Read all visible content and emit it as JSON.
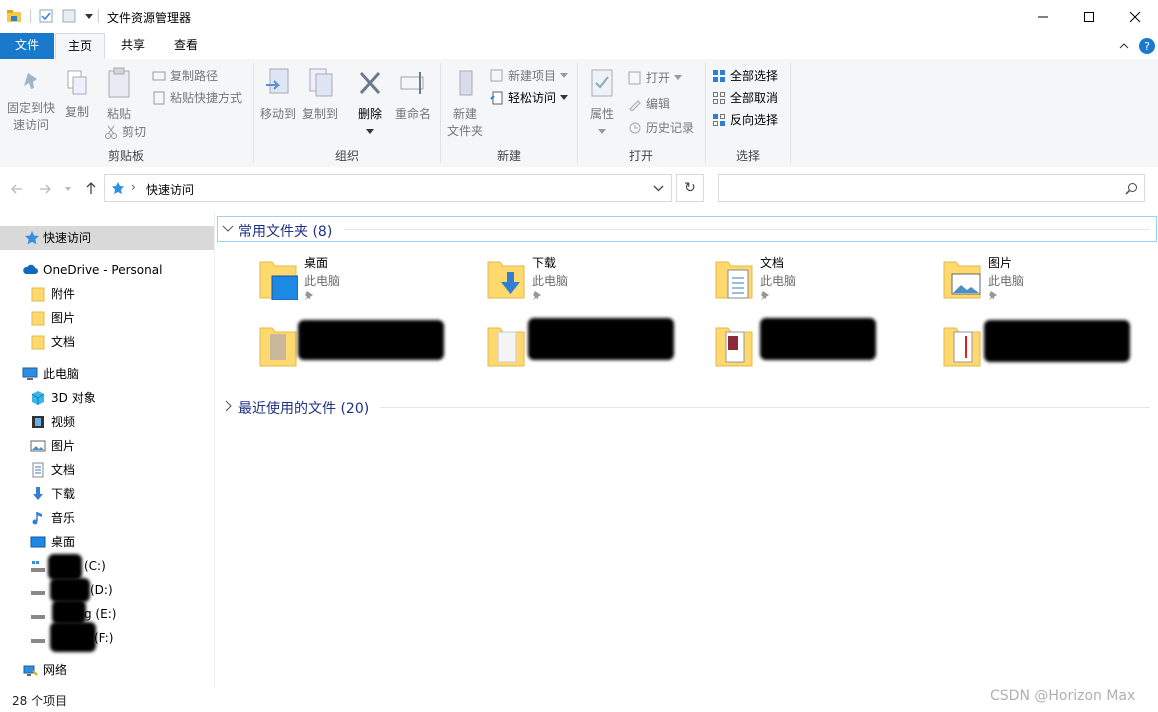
{
  "window": {
    "title": "文件资源管理器"
  },
  "tabs": [
    {
      "label": "文件"
    },
    {
      "label": "主页"
    },
    {
      "label": "共享"
    },
    {
      "label": "查看"
    }
  ],
  "ribbon": {
    "clipboard": {
      "label": "剪贴板",
      "pin_line1": "固定到快",
      "pin_line2": "速访问",
      "copy": "复制",
      "paste": "粘贴",
      "copy_path": "复制路径",
      "paste_shortcut": "粘贴快捷方式",
      "cut": "剪切"
    },
    "organize": {
      "label": "组织",
      "move_to": "移动到",
      "copy_to": "复制到",
      "delete": "删除",
      "rename": "重命名"
    },
    "new": {
      "label": "新建",
      "new_folder_line1": "新建",
      "new_folder_line2": "文件夹",
      "new_item": "新建项目",
      "easy_access": "轻松访问"
    },
    "open": {
      "label": "打开",
      "properties": "属性",
      "open": "打开",
      "edit": "编辑",
      "history": "历史记录"
    },
    "select": {
      "label": "选择",
      "select_all": "全部选择",
      "select_none": "全部取消",
      "invert": "反向选择"
    }
  },
  "address": {
    "path": "快速访问",
    "separator": "›"
  },
  "nav": {
    "quick_access": "快速访问",
    "onedrive": "OneDrive - Personal",
    "onedrive_children": [
      "附件",
      "图片",
      "文档"
    ],
    "this_pc": "此电脑",
    "pc_children": [
      "3D 对象",
      "视频",
      "图片",
      "文档",
      "下载",
      "音乐",
      "桌面"
    ],
    "drives": [
      "(C:)",
      "(D:)",
      "g (E:)",
      "(F:)"
    ],
    "network": "网络"
  },
  "content": {
    "frequent_header": "常用文件夹 (8)",
    "recent_header": "最近使用的文件 (20)",
    "folders": [
      {
        "name": "桌面",
        "location": "此电脑"
      },
      {
        "name": "下载",
        "location": "此电脑"
      },
      {
        "name": "文档",
        "location": "此电脑"
      },
      {
        "name": "图片",
        "location": "此电脑"
      }
    ]
  },
  "status": {
    "items": "28 个项目"
  },
  "watermark": "CSDN @Horizon Max"
}
